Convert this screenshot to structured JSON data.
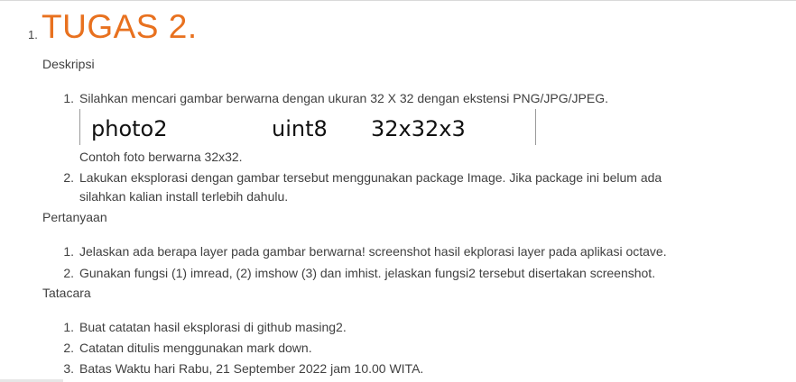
{
  "heading": {
    "number": "1.",
    "title": "TUGAS 2."
  },
  "deskripsi": {
    "label": "Deskripsi",
    "items": [
      {
        "num": "1.",
        "text": "Silahkan mencari gambar berwarna dengan ukuran 32 X 32 dengan ekstensi PNG/JPG/JPEG."
      },
      {
        "num": "2.",
        "text_line1": "Lakukan eksplorasi dengan gambar tersebut menggunakan package Image. Jika package ini belum ada",
        "text_line2": "silahkan kalian install terlebih dahulu."
      }
    ],
    "image_info": {
      "name": "photo2",
      "type": "uint8",
      "size": "32x32x3"
    },
    "caption": "Contoh foto berwarna 32x32."
  },
  "pertanyaan": {
    "label": "Pertanyaan",
    "items": [
      {
        "num": "1.",
        "text": "Jelaskan ada berapa layer pada gambar berwarna! screenshot hasil ekplorasi layer pada aplikasi octave."
      },
      {
        "num": "2.",
        "text": "Gunakan fungsi (1) imread, (2) imshow (3) dan imhist. jelaskan fungsi2 tersebut disertakan screenshot."
      }
    ]
  },
  "tatacara": {
    "label": "Tatacara",
    "items": [
      {
        "num": "1.",
        "text": "Buat catatan hasil eksplorasi di github masing2."
      },
      {
        "num": "2.",
        "text": "Catatan ditulis menggunakan mark down."
      },
      {
        "num": "3.",
        "text": "Batas Waktu hari Rabu, 21 September 2022 jam 10.00 WITA."
      }
    ]
  }
}
